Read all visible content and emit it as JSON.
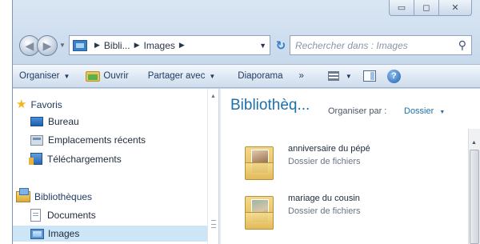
{
  "window": {
    "caption_buttons": {
      "minimize": "▭",
      "maximize": "◻",
      "close": "✕"
    }
  },
  "address": {
    "crumbs": [
      "Bibli...",
      "Images"
    ],
    "search_placeholder": "Rechercher dans : Images"
  },
  "command_bar": {
    "organize": "Organiser",
    "open": "Ouvrir",
    "share": "Partager avec",
    "slideshow": "Diaporama",
    "more": "»"
  },
  "nav": {
    "favorites_header": "Favoris",
    "favorites": [
      "Bureau",
      "Emplacements récents",
      "Téléchargements"
    ],
    "libraries_header": "Bibliothèques",
    "libraries": [
      "Documents",
      "Images"
    ],
    "selected": "Images"
  },
  "library": {
    "title": "Bibliothèq...",
    "arrange_label": "Organiser par :",
    "arrange_value": "Dossier"
  },
  "files": [
    {
      "name": "anniversaire du pépé",
      "type": "Dossier de fichiers"
    },
    {
      "name": "mariage du cousin",
      "type": "Dossier de fichiers"
    }
  ],
  "colors": {
    "link_blue": "#1e6fa8",
    "selection": "#cde6f7",
    "chrome": "#c8d9ec"
  }
}
